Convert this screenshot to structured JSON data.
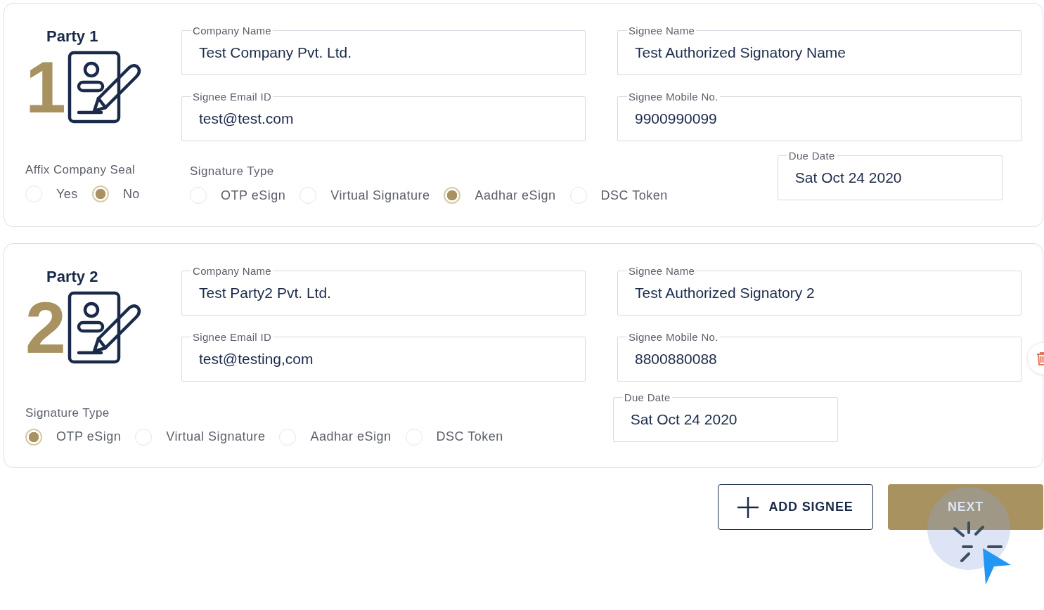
{
  "parties": [
    {
      "title": "Party 1",
      "number": "1",
      "deletable": false,
      "fields": [
        {
          "label": "Company Name",
          "value": "Test Company Pvt. Ltd."
        },
        {
          "label": "Signee Name",
          "value": "Test Authorized Signatory Name"
        },
        {
          "label": "Signee Email ID",
          "value": "test@test.com"
        },
        {
          "label": "Signee Mobile No.",
          "value": "9900990099"
        }
      ],
      "seal": {
        "label": "Affix Company Seal",
        "options": [
          {
            "label": "Yes",
            "selected": false
          },
          {
            "label": "No",
            "selected": true
          }
        ]
      },
      "signature_type": {
        "label": "Signature Type",
        "options": [
          {
            "label": "OTP eSign",
            "selected": false
          },
          {
            "label": "Virtual Signature",
            "selected": false
          },
          {
            "label": "Aadhar eSign",
            "selected": true
          },
          {
            "label": "DSC Token",
            "selected": false
          }
        ]
      },
      "due_date": {
        "label": "Due Date",
        "value": "Sat Oct 24 2020"
      }
    },
    {
      "title": "Party 2",
      "number": "2",
      "deletable": true,
      "fields": [
        {
          "label": "Company Name",
          "value": "Test Party2 Pvt. Ltd."
        },
        {
          "label": "Signee Name",
          "value": "Test Authorized Signatory 2"
        },
        {
          "label": "Signee Email ID",
          "value": "test@testing,com"
        },
        {
          "label": "Signee Mobile No.",
          "value": "8800880088"
        }
      ],
      "signature_type": {
        "label": "Signature Type",
        "options": [
          {
            "label": "OTP eSign",
            "selected": true
          },
          {
            "label": "Virtual Signature",
            "selected": false
          },
          {
            "label": "Aadhar eSign",
            "selected": false
          },
          {
            "label": "DSC Token",
            "selected": false
          }
        ]
      },
      "due_date": {
        "label": "Due Date",
        "value": "Sat Oct 24 2020"
      }
    }
  ],
  "actions": {
    "add_signee": "ADD SIGNEE",
    "next": "NEXT"
  }
}
